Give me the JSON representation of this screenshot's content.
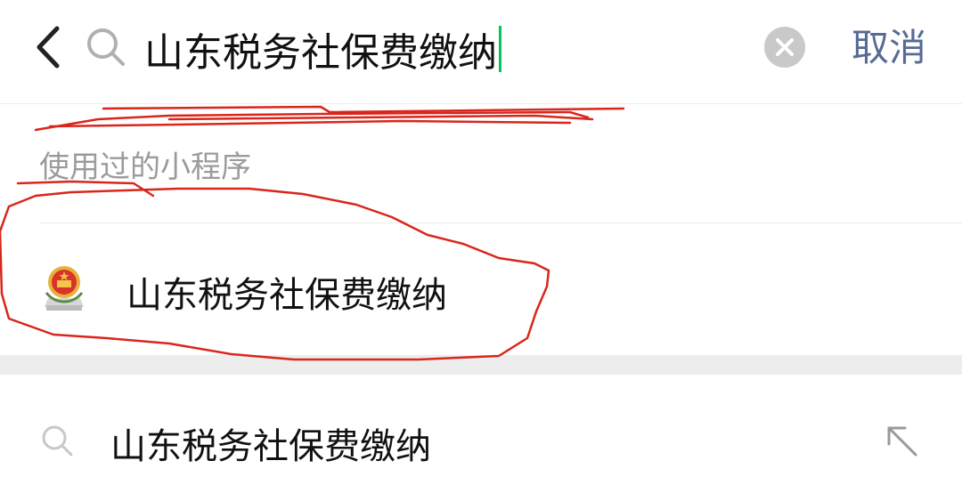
{
  "search": {
    "value": "山东税务社保费缴纳",
    "cancel_label": "取消"
  },
  "sections": {
    "used_mini_programs_title": "使用过的小程序"
  },
  "mini_program": {
    "name": "山东税务社保费缴纳",
    "icon": "tax-emblem-icon"
  },
  "suggestion": {
    "text": "山东税务社保费缴纳",
    "icon": "search-icon"
  },
  "colors": {
    "accent_link": "#576b95",
    "caret": "#07c160",
    "annotation": "#d9261c",
    "secondary_text": "#9b9b9b"
  }
}
